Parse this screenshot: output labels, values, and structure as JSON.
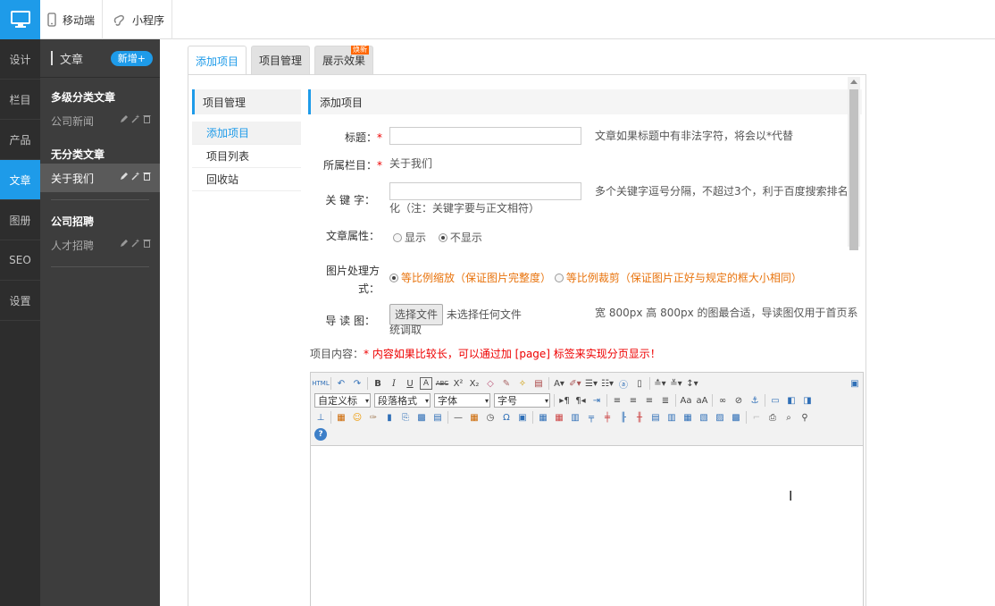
{
  "topbar": {
    "mobile_label": "移动端",
    "miniprogram_label": "小程序",
    "colors": {
      "accent": "#1e9be9"
    }
  },
  "mainnav": {
    "items": [
      {
        "label": "设计"
      },
      {
        "label": "栏目"
      },
      {
        "label": "产品"
      },
      {
        "label": "文章",
        "active": true
      },
      {
        "label": "图册"
      },
      {
        "label": "SEO"
      },
      {
        "label": "设置"
      }
    ]
  },
  "subnav": {
    "title": "文章",
    "new_label": "新增+",
    "groups": [
      {
        "title": "多级分类文章",
        "items": [
          {
            "label": "公司新闻"
          }
        ]
      },
      {
        "title": "无分类文章",
        "items": [
          {
            "label": "关于我们",
            "active": true
          }
        ]
      },
      {
        "title": "公司招聘",
        "items": [
          {
            "label": "人才招聘"
          }
        ]
      }
    ]
  },
  "tabs": [
    {
      "label": "添加项目",
      "active": true
    },
    {
      "label": "项目管理"
    },
    {
      "label": "展示效果",
      "badge": "焕新"
    }
  ],
  "leftmenu": {
    "title": "项目管理",
    "items": [
      {
        "label": "添加项目",
        "active": true
      },
      {
        "label": "项目列表"
      },
      {
        "label": "回收站"
      }
    ]
  },
  "form": {
    "header": "添加项目",
    "title_label": "标题：",
    "title_value": "",
    "title_hint": "文章如果标题中有非法字符，将会以*代替",
    "column_label": "所属栏目：",
    "column_value": "关于我们",
    "keywords_label": "关 键 字：",
    "keywords_value": "",
    "keywords_hint_1": "多个关键字逗号分隔，不超过3个，利于百度搜索排名优",
    "keywords_hint_2": "化（注：关键字要与正文相符）",
    "attr_label": "文章属性：",
    "attr_options": [
      {
        "label": "显示",
        "checked": false
      },
      {
        "label": "不显示",
        "checked": true
      }
    ],
    "img_label_1": "图片处理方",
    "img_label_2": "式：",
    "img_options": [
      {
        "label": "等比例缩放（保证图片完整度）",
        "checked": true
      },
      {
        "label": "等比例裁剪（保证图片正好与规定的框大小相同）",
        "checked": false
      }
    ],
    "guide_label": "导 读 图：",
    "file_button": "选择文件",
    "file_status": "未选择任何文件",
    "guide_hint_1": "宽 800px 高 800px 的图最合适，导读图仅用于首页系",
    "guide_hint_2": "统调取",
    "content_label": "项目内容：",
    "content_hint": "内容如果比较长，可以通过加 [page] 标签来实现分页显示！"
  },
  "editor": {
    "style_select": "自定义标",
    "para_select": "段落格式",
    "font_select": "字体",
    "size_select": "字号"
  }
}
